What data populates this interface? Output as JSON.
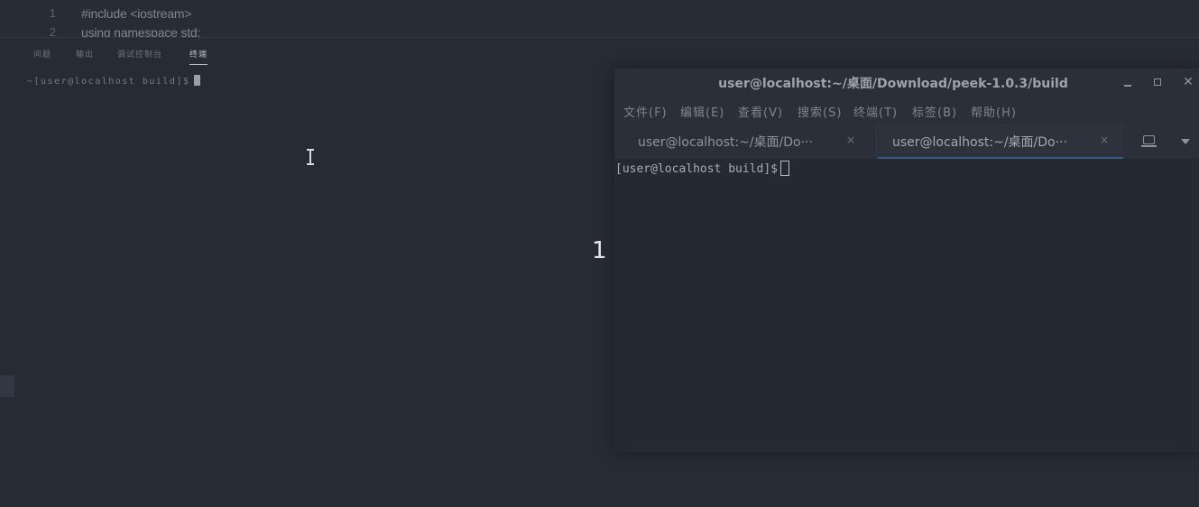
{
  "editor": {
    "lines": [
      {
        "number": "1",
        "code": "#include <iostream>"
      },
      {
        "number": "2",
        "code": "using namespace std;"
      }
    ]
  },
  "panel": {
    "tabs": [
      "问题",
      "输出",
      "调试控制台",
      "终端"
    ],
    "active_tab": "终端",
    "prompt": "~[user@localhost build]$"
  },
  "overlay": {
    "page_number": "1"
  },
  "terminal": {
    "title": "user@localhost:~/桌面/Download/peek-1.0.3/build",
    "menu": [
      "文件(F)",
      "编辑(E)",
      "查看(V)",
      "搜索(S)",
      "终端(T)",
      "标签(B)",
      "帮助(H)"
    ],
    "tabs": [
      {
        "label": "user@localhost:~/桌面/Do···",
        "close": "×"
      },
      {
        "label": "user@localhost:~/桌面/Do···",
        "close": "×"
      }
    ],
    "prompt": "[user@localhost build]$"
  },
  "colors": {
    "background": "#272b35",
    "terminal_body": "#252931",
    "active_tab_accent": "#3d5a85"
  }
}
